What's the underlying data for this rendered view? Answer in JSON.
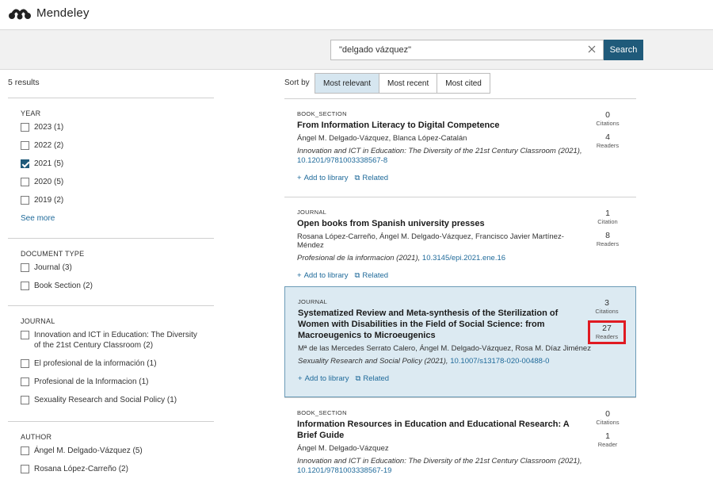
{
  "brand": {
    "name": "Mendeley",
    "icon": "mendeley-logo"
  },
  "search": {
    "value": "\"delgado vázquez\"",
    "button_label": "Search"
  },
  "results_count": "5 results",
  "sidebar": {
    "facets": [
      {
        "title": "YEAR",
        "items": [
          {
            "label": "2023 (1)",
            "checked": false
          },
          {
            "label": "2022 (2)",
            "checked": false
          },
          {
            "label": "2021 (5)",
            "checked": true
          },
          {
            "label": "2020 (5)",
            "checked": false
          },
          {
            "label": "2019 (2)",
            "checked": false
          }
        ],
        "see_more": "See more"
      },
      {
        "title": "DOCUMENT TYPE",
        "items": [
          {
            "label": "Journal (3)",
            "checked": false
          },
          {
            "label": "Book Section (2)",
            "checked": false
          }
        ]
      },
      {
        "title": "JOURNAL",
        "items": [
          {
            "label": "Innovation and ICT in Education: The Diversity of the 21st Century Classroom (2)",
            "checked": false
          },
          {
            "label": "El profesional de la información (1)",
            "checked": false
          },
          {
            "label": "Profesional de la Informacion (1)",
            "checked": false
          },
          {
            "label": "Sexuality Research and Social Policy (1)",
            "checked": false
          }
        ]
      },
      {
        "title": "AUTHOR",
        "items": [
          {
            "label": "Ángel M. Delgado-Vázquez (5)",
            "checked": false
          },
          {
            "label": "Rosana López-Carreño (2)",
            "checked": false
          }
        ]
      }
    ]
  },
  "sort": {
    "label": "Sort by",
    "options": [
      "Most relevant",
      "Most recent",
      "Most cited"
    ],
    "active": "Most relevant"
  },
  "actions": {
    "add": "Add to library",
    "related": "Related"
  },
  "results": [
    {
      "type": "BOOK_SECTION",
      "title": "From Information Literacy to Digital Competence",
      "authors": "Ángel M. Delgado-Vázquez, Blanca López-Catalán",
      "source": "Innovation and ICT in Education: The Diversity of the 21st Century Classroom (2021),",
      "doi": "10.1201/9781003338567-8",
      "citations": "0",
      "citations_label": "Citations",
      "readers": "4",
      "readers_label": "Readers"
    },
    {
      "type": "JOURNAL",
      "title": "Open books from Spanish university presses",
      "authors": "Rosana López-Carreño, Ángel M. Delgado-Vázquez, Francisco Javier Martínez-Méndez",
      "source": "Profesional de la informacion (2021),",
      "doi": "10.3145/epi.2021.ene.16",
      "citations": "1",
      "citations_label": "Citation",
      "readers": "8",
      "readers_label": "Readers"
    },
    {
      "type": "JOURNAL",
      "title": "Systematized Review and Meta-synthesis of the Sterilization of Women with Disabilities in the Field of Social Science: from Macroeugenics to Microeugenics",
      "authors": "Mª de las Mercedes Serrato Calero, Ángel M. Delgado-Vázquez, Rosa M. Díaz Jiménez",
      "source": "Sexuality Research and Social Policy (2021),",
      "doi": "10.1007/s13178-020-00488-0",
      "citations": "3",
      "citations_label": "Citations",
      "readers": "27",
      "readers_label": "Readers"
    },
    {
      "type": "BOOK_SECTION",
      "title": "Information Resources in Education and Educational Research: A Brief Guide",
      "authors": "Ángel M. Delgado-Vázquez",
      "source": "Innovation and ICT in Education: The Diversity of the 21st Century Classroom (2021),",
      "doi": "10.1201/9781003338567-19",
      "citations": "0",
      "citations_label": "Citations",
      "readers": "1",
      "readers_label": "Reader"
    }
  ],
  "colors": {
    "accent": "#1f5a7a",
    "link": "#1f6a9a",
    "highlight_bg": "#dceaf2",
    "marker": "#e01a22"
  }
}
